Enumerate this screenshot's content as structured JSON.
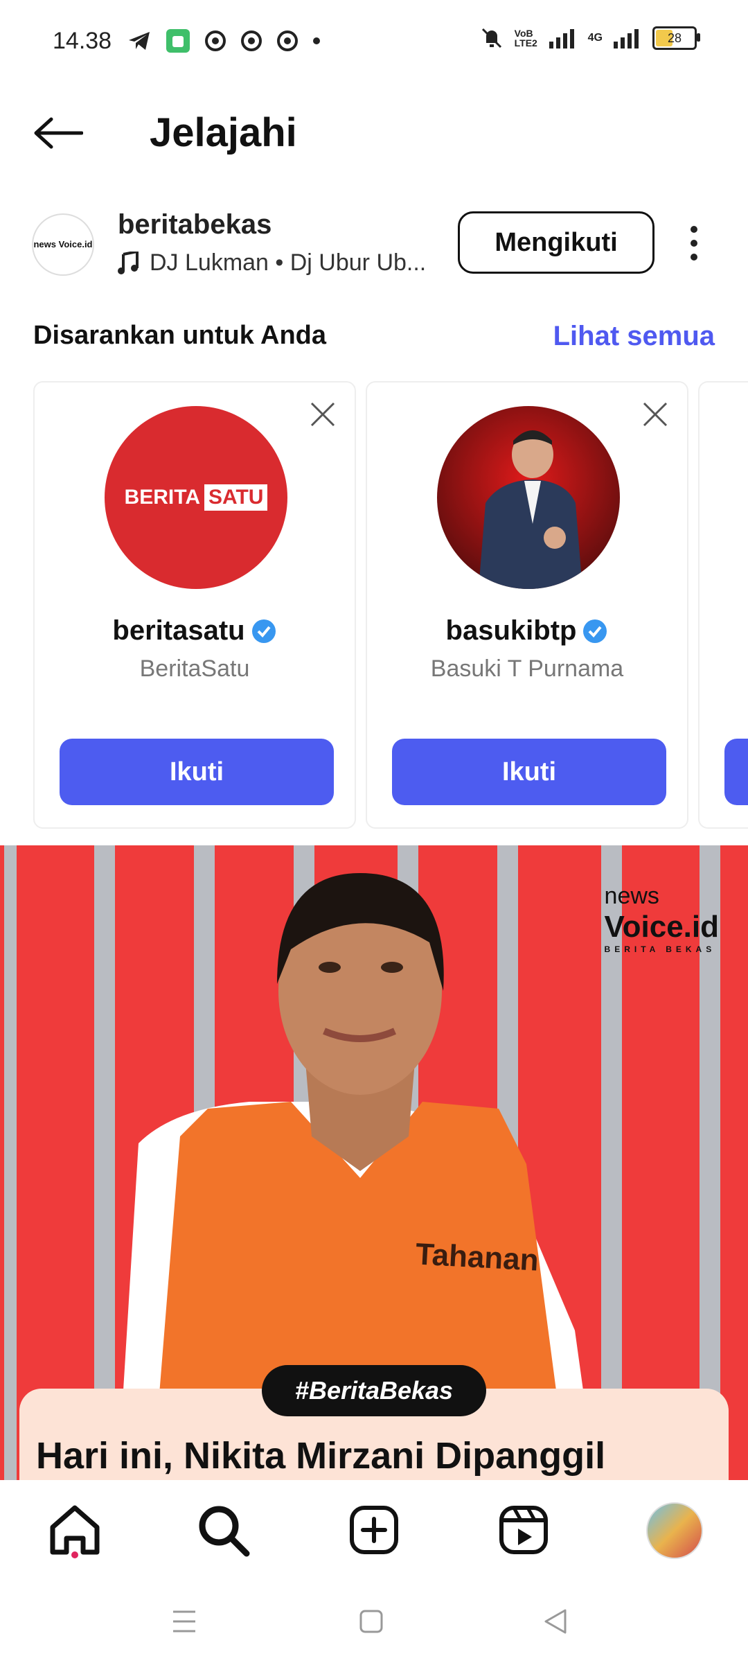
{
  "status_bar": {
    "time": "14.38",
    "battery": "28",
    "network_labels": [
      "VoB LTE2",
      "4G"
    ]
  },
  "header": {
    "title": "Jelajahi"
  },
  "account": {
    "username": "beritabekas",
    "music": "DJ Lukman • Dj Ubur Ub...",
    "follow_label": "Mengikuti",
    "avatar_text": "news Voice.id"
  },
  "suggestions": {
    "title": "Disarankan untuk Anda",
    "see_all": "Lihat semua",
    "cards": [
      {
        "username": "beritasatu",
        "full_name": "BeritaSatu",
        "button": "Ikuti",
        "logo_left": "BERITA",
        "logo_right": "SATU"
      },
      {
        "username": "basukibtp",
        "full_name": "Basuki T Purnama",
        "button": "Ikuti"
      }
    ]
  },
  "post": {
    "logo_top": "news",
    "logo_main": "Voice.id",
    "logo_sub": "BERITA BEKAS",
    "vest_text": "Tahanan",
    "hashtag": "#BeritaBekas",
    "caption": "Hari ini, Nikita Mirzani Dipanggil"
  },
  "colors": {
    "accent": "#4d5cf0",
    "link": "#4f59f0",
    "post_bg": "#ef3b3b",
    "caption_bg": "#fde3d6"
  },
  "icons": {
    "nav": [
      "home-icon",
      "search-icon",
      "create-icon",
      "reels-icon",
      "profile-avatar"
    ]
  }
}
